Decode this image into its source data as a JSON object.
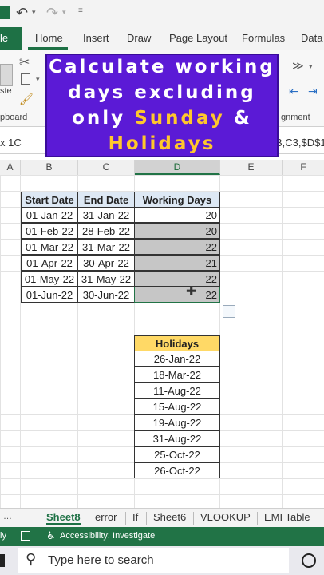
{
  "qat": {
    "icons": [
      "save-icon",
      "undo-icon",
      "redo-icon",
      "customize-icon"
    ]
  },
  "ribbon_tabs": {
    "file": "le",
    "home": "Home",
    "insert": "Insert",
    "draw": "Draw",
    "page_layout": "Page Layout",
    "formulas": "Formulas",
    "data": "Data"
  },
  "ribbon": {
    "paste": "ste",
    "clipboard": "pboard",
    "alignment": "gnment"
  },
  "formula_bar": {
    "name_box": "x 1C",
    "formula_tail": "B,C3,$D$1"
  },
  "banner": {
    "line1": "Calculate working",
    "line2": "days excluding",
    "line3_prefix": "only ",
    "line3_highlight": "Sunday",
    "line3_suffix": " &",
    "line4": "Holidays"
  },
  "columns": [
    "A",
    "B",
    "C",
    "D",
    "E",
    "F"
  ],
  "table": {
    "headers": [
      "Start Date",
      "End Date",
      "Working Days"
    ],
    "rows": [
      [
        "01-Jan-22",
        "31-Jan-22",
        "20"
      ],
      [
        "01-Feb-22",
        "28-Feb-22",
        "20"
      ],
      [
        "01-Mar-22",
        "31-Mar-22",
        "22"
      ],
      [
        "01-Apr-22",
        "30-Apr-22",
        "21"
      ],
      [
        "01-May-22",
        "31-May-22",
        "22"
      ],
      [
        "01-Jun-22",
        "30-Jun-22",
        "22"
      ]
    ]
  },
  "holidays": {
    "header": "Holidays",
    "dates": [
      "26-Jan-22",
      "18-Mar-22",
      "11-Aug-22",
      "15-Aug-22",
      "19-Aug-22",
      "31-Aug-22",
      "25-Oct-22",
      "26-Oct-22"
    ]
  },
  "sheet_tabs": [
    "Sheet8",
    "error",
    "If",
    "Sheet6",
    "VLOOKUP",
    "EMI Table"
  ],
  "status": {
    "ready": "ly",
    "accessibility": "Accessibility: Investigate"
  },
  "taskbar": {
    "search_placeholder": "Type here to search"
  },
  "colors": {
    "excel_green": "#217346",
    "banner": "#5b1ad6",
    "highlight": "#ffc72c",
    "header_fill": "#dde8f4",
    "holiday_header": "#ffd966"
  }
}
